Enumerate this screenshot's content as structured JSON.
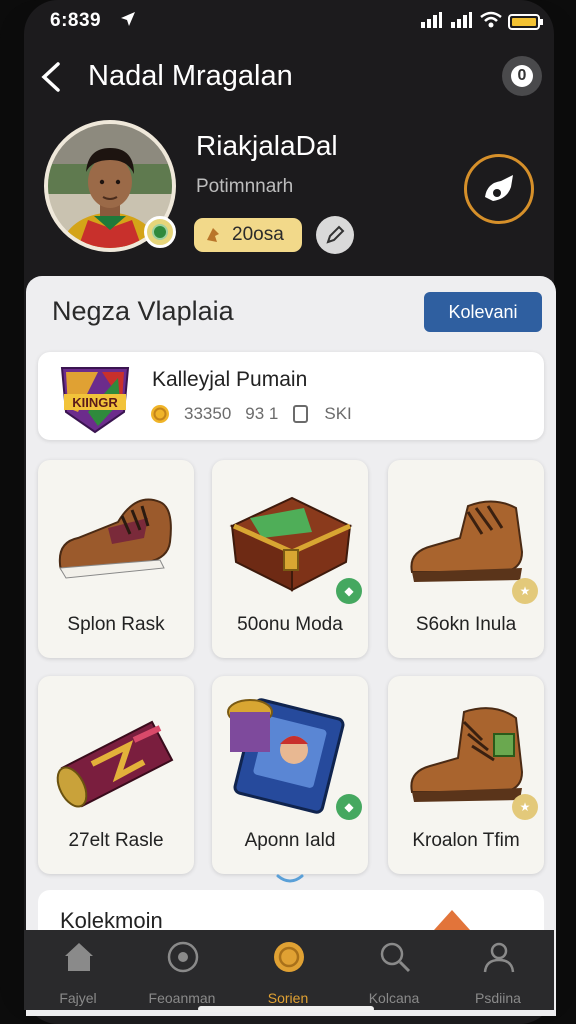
{
  "status": {
    "time": "6:839"
  },
  "header": {
    "title": "Nadal Mragalan",
    "badge": "0"
  },
  "profile": {
    "name": "RiakjalaDal",
    "subtitle": "Potimnnarh",
    "coins": "20osa"
  },
  "panel": {
    "title": "Negza Vlaplaia",
    "button_label": "Kolevani"
  },
  "featured": {
    "logo_text": "KIINGR",
    "title": "Kalleyjal Pumain",
    "stat_coins": "33350",
    "stat_cards": "93 1",
    "stat_items": "SKI"
  },
  "items": [
    {
      "label": "Splon Rask",
      "kind": "boot"
    },
    {
      "label": "50onu Moda",
      "kind": "chest"
    },
    {
      "label": "S6okn Inula",
      "kind": "brown-boot"
    },
    {
      "label": "27elt Rasle",
      "kind": "can"
    },
    {
      "label": "Aponn Iald",
      "kind": "card-pack"
    },
    {
      "label": "Kroalon Tfim",
      "kind": "hiking-boot"
    }
  ],
  "collection": {
    "title": "Kolekmoin"
  },
  "tabs": [
    {
      "label": "Fajyel",
      "icon": "home-icon"
    },
    {
      "label": "Feoanman",
      "icon": "football-icon"
    },
    {
      "label": "Sorien",
      "icon": "coin-icon"
    },
    {
      "label": "Kolcana",
      "icon": "search-icon"
    },
    {
      "label": "Psdiina",
      "icon": "profile-icon"
    }
  ],
  "colors": {
    "accent": "#e0a133",
    "button": "#2f5fa0",
    "background": "#1c1b1d"
  }
}
